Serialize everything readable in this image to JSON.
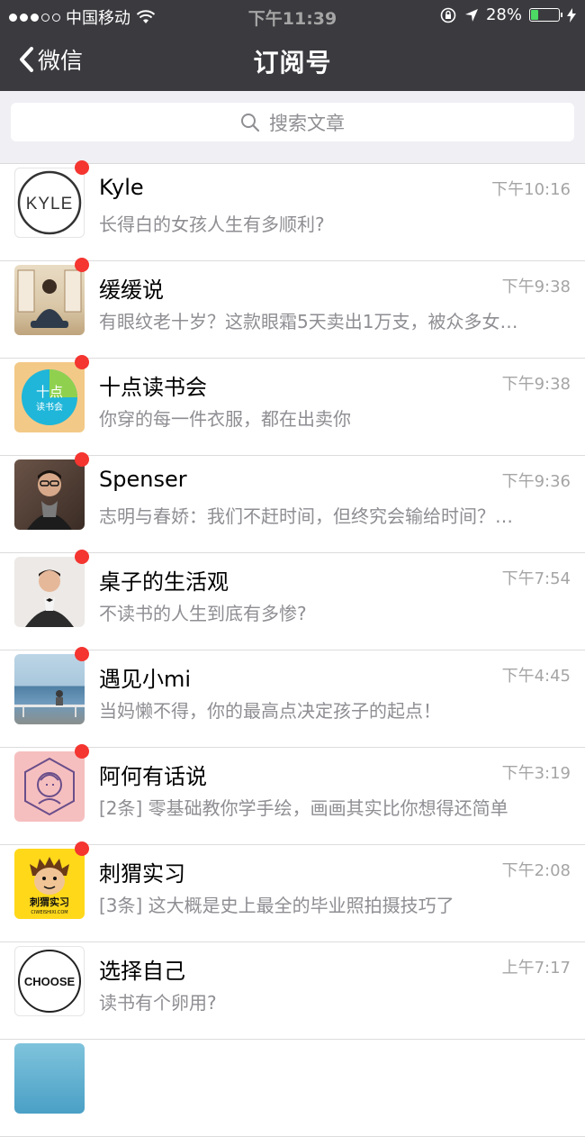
{
  "status": {
    "carrier": "中国移动",
    "time": "下午11:39",
    "battery_pct": "28%",
    "battery_level": 0.28,
    "colors": {
      "battery": "#4cd964"
    }
  },
  "nav": {
    "back_label": "微信",
    "title": "订阅号"
  },
  "search": {
    "placeholder": "搜索文章"
  },
  "colors": {
    "badge": "#f43530",
    "navbar": "#3a3a3f",
    "background": "#efeff4"
  },
  "items": [
    {
      "name": "Kyle",
      "time": "下午10:16",
      "message": "长得白的女孩人生有多顺利?",
      "unread": true,
      "avatar_text": "KYLE"
    },
    {
      "name": "缓缓说",
      "time": "下午9:38",
      "message": "有眼纹老十岁？这款眼霜5天卖出1万支，被众多女…",
      "unread": true
    },
    {
      "name": "十点读书会",
      "time": "下午9:38",
      "message": "你穿的每一件衣服，都在出卖你",
      "unread": true,
      "avatar_text": "十点",
      "avatar_subtext": "读书会"
    },
    {
      "name": "Spenser",
      "time": "下午9:36",
      "message": "志明与春娇：我们不赶时间，但终究会输给时间？…",
      "unread": true
    },
    {
      "name": "桌子的生活观",
      "time": "下午7:54",
      "message": "不读书的人生到底有多惨?",
      "unread": true
    },
    {
      "name": "遇见小mi",
      "time": "下午4:45",
      "message": "当妈懒不得，你的最高点决定孩子的起点！",
      "unread": true
    },
    {
      "name": "阿何有话说",
      "time": "下午3:19",
      "message": "[2条] 零基础教你学手绘，画画其实比你想得还简单",
      "unread": true
    },
    {
      "name": "刺猬实习",
      "time": "下午2:08",
      "message": "[3条] 这大概是史上最全的毕业照拍摄技巧了",
      "unread": true,
      "avatar_text": "刺猬实习",
      "avatar_subtext": "CIWEISHIXI.COM"
    },
    {
      "name": "选择自己",
      "time": "上午7:17",
      "message": "读书有个卵用?",
      "unread": false,
      "avatar_text": "CHOOSE"
    }
  ]
}
